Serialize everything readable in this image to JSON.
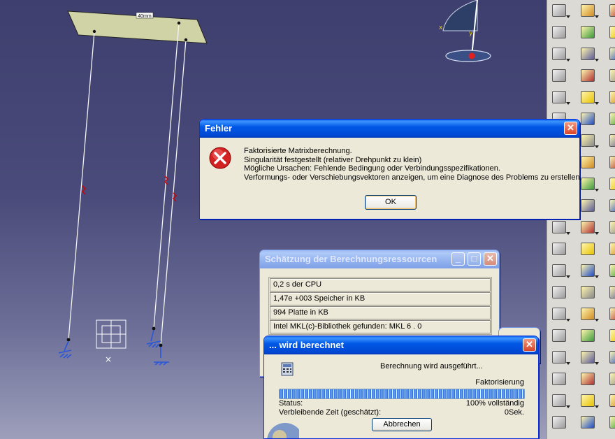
{
  "scene": {
    "dimension_label": "40mm"
  },
  "error_dialog": {
    "title": "Fehler",
    "close_glyph": "✕",
    "icon": "error-x-icon",
    "lines": [
      "Faktorisierte Matrixberechnung.",
      "Singularität festgestellt (relativer Drehpunkt zu klein)",
      "Mögliche Ursachen: Fehlende Bedingung oder Verbindungsspezifikationen.",
      "Verformungs- oder Verschiebungsvektoren anzeigen, um eine Diagnose des Problems zu erstellen."
    ],
    "ok_label": "OK"
  },
  "resources_dialog": {
    "title": "Schätzung der Berechnungsressourcen",
    "minimize_glyph": "_",
    "maximize_glyph": "□",
    "close_glyph": "✕",
    "rows": [
      "0,2 s der CPU",
      "1,47e +003 Speicher in KB",
      "994 Platte in KB",
      "Intel MKL(c)-Bibliothek gefunden: MKL 6 . 0"
    ]
  },
  "progress_dialog": {
    "title": "... wird berechnet",
    "close_glyph": "✕",
    "message": "Berechnung wird ausgeführt...",
    "phase": "Faktorisierung",
    "progress": 1.0,
    "status_label": "Status:",
    "status_value": "100% vollständig",
    "remaining_label": "Verbleibende Zeit (geschätzt):",
    "remaining_value": "0Sek.",
    "cancel_label": "Abbrechen"
  },
  "toolbar": {
    "icons": [
      "calendar-icon",
      "layers-icon",
      "rotate-icon",
      "plate-icon",
      "arrow-icon",
      "surface-icon",
      "bracket-icon",
      "sheet-icon",
      "cube-icon",
      "pin-icon",
      "axis-icon",
      "wheel-icon",
      "gear-icon",
      "clamp-icon",
      "scroll-icon",
      "box-icon",
      "stamp-icon",
      "cog-icon",
      "magnet-icon",
      "zoom-icon"
    ],
    "colors": {
      "panel": "#dcdad5",
      "accent_yellow": "#e8c200",
      "accent_blue": "#1c4ac8"
    }
  },
  "colors": {
    "background_top": "#3e3f6e",
    "background_bottom": "#9d9fbb",
    "plate": "#cfd3a6",
    "xp_title_blue": "#0058e6",
    "dialog_face": "#ece9d8"
  }
}
